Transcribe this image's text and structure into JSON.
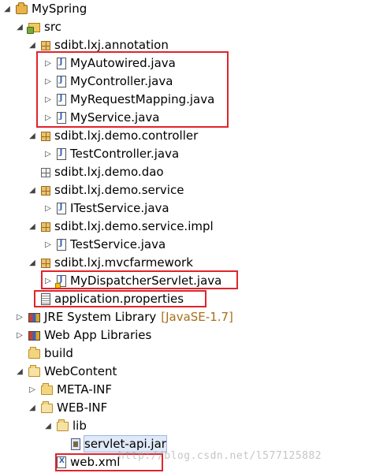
{
  "tree": {
    "project": "MySpring",
    "src": "src",
    "packages": {
      "annotation": {
        "name": "sdibt.lxj.annotation",
        "files": [
          "MyAutowired.java",
          "MyController.java",
          "MyRequestMapping.java",
          "MyService.java"
        ]
      },
      "controller": {
        "name": "sdibt.lxj.demo.controller",
        "files": [
          "TestController.java"
        ]
      },
      "dao": {
        "name": "sdibt.lxj.demo.dao"
      },
      "service": {
        "name": "sdibt.lxj.demo.service",
        "files": [
          "ITestService.java"
        ]
      },
      "service_impl": {
        "name": "sdibt.lxj.demo.service.impl",
        "files": [
          "TestService.java"
        ]
      },
      "mvc": {
        "name": "sdibt.lxj.mvcfarmework",
        "files": [
          "MyDispatcherServlet.java"
        ]
      }
    },
    "properties_file": "application.properties",
    "jre_library": "JRE System Library",
    "jre_version": "[JavaSE-1.7]",
    "web_app_libraries": "Web App Libraries",
    "build": "build",
    "webcontent": "WebContent",
    "meta_inf": "META-INF",
    "web_inf": "WEB-INF",
    "lib": "lib",
    "jar": "servlet-api.jar",
    "web_xml": "web.xml"
  },
  "watermark": "http://blog.csdn.net/l577125882",
  "colors": {
    "highlight_box": "#e0242c",
    "selection_bg": "#dfe9f7",
    "decorator_text": "#a86f1a"
  }
}
